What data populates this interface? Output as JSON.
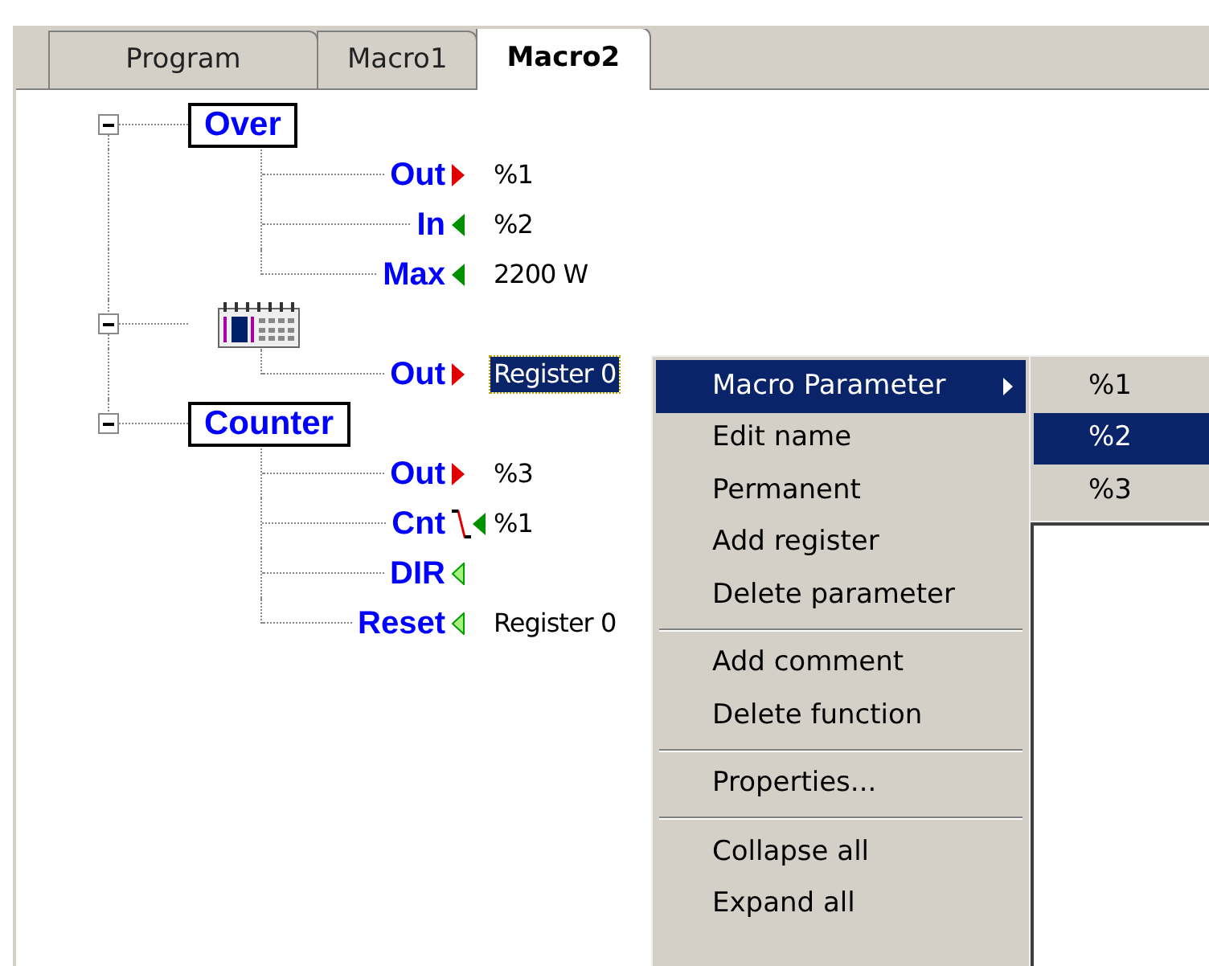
{
  "tabs": [
    {
      "label": "Program",
      "selected": false
    },
    {
      "label": "Macro1",
      "selected": false
    },
    {
      "label": "Macro2",
      "selected": true
    }
  ],
  "functions": [
    {
      "kind": "block",
      "name": "Over",
      "expanded": true,
      "params": [
        {
          "name": "Out",
          "kind": "out",
          "value": "%1",
          "selected": false
        },
        {
          "name": "In",
          "kind": "in",
          "value": "%2",
          "selected": false
        },
        {
          "name": "Max",
          "kind": "in",
          "value": "2200 W",
          "selected": false
        }
      ]
    },
    {
      "kind": "calendar",
      "expanded": true,
      "params": [
        {
          "name": "Out",
          "kind": "out",
          "value": "Register 0",
          "selected": true
        }
      ]
    },
    {
      "kind": "block",
      "name": "Counter",
      "expanded": true,
      "params": [
        {
          "name": "Out",
          "kind": "out",
          "value": "%3",
          "selected": false
        },
        {
          "name": "Cnt",
          "kind": "in",
          "falling_edge": true,
          "value": "%1",
          "selected": false
        },
        {
          "name": "DIR",
          "kind": "in_open",
          "selected": false
        },
        {
          "name": "Reset",
          "kind": "in_open",
          "value": "Register 0",
          "selected": false
        }
      ]
    }
  ],
  "context_menu": {
    "groups": [
      [
        {
          "label": "Macro Parameter",
          "submenu": true,
          "selected": true
        },
        {
          "label": "Edit name",
          "selected": false
        },
        {
          "label": "Permanent",
          "selected": false
        },
        {
          "label": "Add register",
          "selected": false
        },
        {
          "label": "Delete parameter",
          "selected": false
        }
      ],
      [
        {
          "label": "Add comment",
          "selected": false
        },
        {
          "label": "Delete function",
          "selected": false
        }
      ],
      [
        {
          "label": "Properties...",
          "selected": false
        }
      ],
      [
        {
          "label": "Collapse all",
          "selected": false
        },
        {
          "label": "Expand all",
          "selected": false
        }
      ]
    ],
    "submenu": [
      {
        "label": "%1",
        "selected": false
      },
      {
        "label": "%2",
        "selected": true
      },
      {
        "label": "%3",
        "selected": false
      }
    ]
  }
}
